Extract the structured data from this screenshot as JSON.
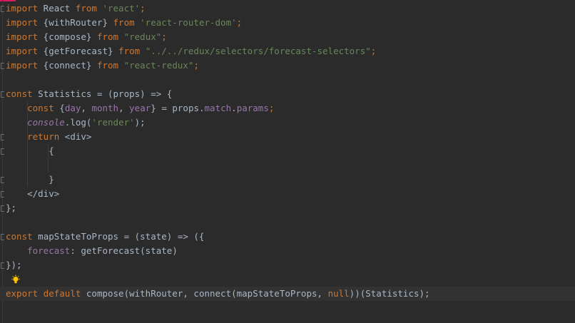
{
  "code": {
    "lines": [
      [
        {
          "t": "import",
          "c": "kw"
        },
        {
          "t": " React ",
          "c": ""
        },
        {
          "t": "from",
          "c": "kw"
        },
        {
          "t": " ",
          "c": ""
        },
        {
          "t": "'react'",
          "c": "str"
        },
        {
          "t": ";",
          "c": "kw"
        }
      ],
      [
        {
          "t": "import",
          "c": "kw"
        },
        {
          "t": " {withRouter} ",
          "c": ""
        },
        {
          "t": "from",
          "c": "kw"
        },
        {
          "t": " ",
          "c": ""
        },
        {
          "t": "'react-router-dom'",
          "c": "str"
        },
        {
          "t": ";",
          "c": "kw"
        }
      ],
      [
        {
          "t": "import",
          "c": "kw"
        },
        {
          "t": " {compose} ",
          "c": ""
        },
        {
          "t": "from",
          "c": "kw"
        },
        {
          "t": " ",
          "c": ""
        },
        {
          "t": "\"redux\"",
          "c": "str"
        },
        {
          "t": ";",
          "c": "kw"
        }
      ],
      [
        {
          "t": "import",
          "c": "kw"
        },
        {
          "t": " {getForecast} ",
          "c": ""
        },
        {
          "t": "from",
          "c": "kw"
        },
        {
          "t": " ",
          "c": ""
        },
        {
          "t": "\"../../redux/selectors/forecast-selectors\"",
          "c": "str"
        },
        {
          "t": ";",
          "c": "kw"
        }
      ],
      [
        {
          "t": "import",
          "c": "kw"
        },
        {
          "t": " {connect} ",
          "c": ""
        },
        {
          "t": "from",
          "c": "kw"
        },
        {
          "t": " ",
          "c": ""
        },
        {
          "t": "\"react-redux\"",
          "c": "str"
        },
        {
          "t": ";",
          "c": "kw"
        }
      ],
      [],
      [
        {
          "t": "const",
          "c": "kw"
        },
        {
          "t": " Statistics = (props) => {",
          "c": ""
        }
      ],
      [
        {
          "t": "    ",
          "c": ""
        },
        {
          "t": "const",
          "c": "kw"
        },
        {
          "t": " {",
          "c": ""
        },
        {
          "t": "day",
          "c": "param"
        },
        {
          "t": ", ",
          "c": ""
        },
        {
          "t": "month",
          "c": "param"
        },
        {
          "t": ", ",
          "c": ""
        },
        {
          "t": "year",
          "c": "param"
        },
        {
          "t": "} = props.",
          "c": ""
        },
        {
          "t": "match",
          "c": "prop"
        },
        {
          "t": ".",
          "c": ""
        },
        {
          "t": "params",
          "c": "prop"
        },
        {
          "t": ";",
          "c": "kw"
        }
      ],
      [
        {
          "t": "    ",
          "c": ""
        },
        {
          "t": "console",
          "c": "prop italic"
        },
        {
          "t": ".log(",
          "c": ""
        },
        {
          "t": "'render'",
          "c": "str"
        },
        {
          "t": ");",
          "c": ""
        }
      ],
      [
        {
          "t": "    ",
          "c": ""
        },
        {
          "t": "return",
          "c": "kw"
        },
        {
          "t": " <div>",
          "c": ""
        }
      ],
      [
        {
          "t": "        {",
          "c": ""
        }
      ],
      [],
      [
        {
          "t": "        }",
          "c": ""
        }
      ],
      [
        {
          "t": "    </div>",
          "c": ""
        }
      ],
      [
        {
          "t": "};",
          "c": ""
        }
      ],
      [],
      [
        {
          "t": "const",
          "c": "kw"
        },
        {
          "t": " mapStateToProps = (state) => ({",
          "c": ""
        }
      ],
      [
        {
          "t": "    ",
          "c": ""
        },
        {
          "t": "forecast",
          "c": "prop"
        },
        {
          "t": ": getForecast(state)",
          "c": ""
        }
      ],
      [
        {
          "t": "});",
          "c": ""
        }
      ],
      [],
      [
        {
          "t": "export",
          "c": "kw"
        },
        {
          "t": " ",
          "c": ""
        },
        {
          "t": "default",
          "c": "kw"
        },
        {
          "t": " compose(withRouter, connect(mapStateToProps, ",
          "c": ""
        },
        {
          "t": "null",
          "c": "kw"
        },
        {
          "t": "))(Statistics);",
          "c": ""
        }
      ]
    ]
  },
  "icons": {
    "intention_bulb": "lightbulb-icon"
  },
  "colors": {
    "background": "#2b2b2b",
    "keyword": "#cc7832",
    "string": "#6a8759",
    "property": "#9876aa",
    "text": "#a9b7c6",
    "bulb": "#ffc100",
    "accent": "#d81b60"
  }
}
